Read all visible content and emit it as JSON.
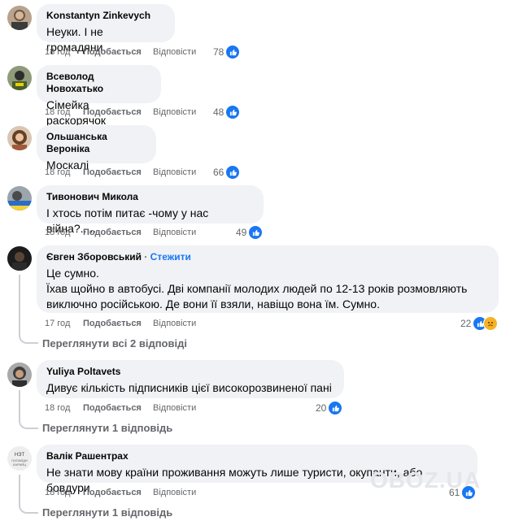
{
  "comments": [
    {
      "author": "Konstantyn Zinkevych",
      "text": "Неуки. І не громадяни.",
      "time": "18 год",
      "like": "Подобається",
      "reply": "Відповісти",
      "count": "78"
    },
    {
      "author": "Всеволод Новохатько",
      "text": "Сімейка раскорячок",
      "time": "18 год",
      "like": "Подобається",
      "reply": "Відповісти",
      "count": "48"
    },
    {
      "author": "Ольшанська Вероніка",
      "text": "Москалі",
      "time": "18 год",
      "like": "Подобається",
      "reply": "Відповісти",
      "count": "66"
    },
    {
      "author": "Тивонович Микола",
      "text": "І хтось потім питає -чому у нас війна?.....",
      "time": "18 год",
      "like": "Подобається",
      "reply": "Відповісти",
      "count": "49"
    },
    {
      "author": "Євген Зборовський",
      "follow_dot": "·",
      "follow": "Стежити",
      "line1": "Це сумно.",
      "line2": "Їхав щойно в автобусі. Дві компанії молодих людей по 12-13 років розмовляють",
      "line3": "виключно російською. Де вони її взяли, навіщо вона їм. Сумно.",
      "time": "17 год",
      "like": "Подобається",
      "reply": "Відповісти",
      "count": "22",
      "see_replies": "Переглянути всі 2 відповіді"
    },
    {
      "author": "Yuliya Poltavets",
      "text": "Дивує кількість підписників цієї високорозвиненої пані",
      "time": "18 год",
      "like": "Подобається",
      "reply": "Відповісти",
      "count": "20",
      "see_replies": "Переглянути 1 відповідь"
    },
    {
      "author": "Валік Рашентрах",
      "text": "Не знати мову країни проживання можуть лише туристи, окупанти, або бовдури",
      "time": "18 год",
      "like": "Подобається",
      "reply": "Відповісти",
      "count": "61",
      "see_replies": "Переглянути 1 відповідь"
    }
  ],
  "watermark": "OBOZ.UA",
  "colors": {
    "link": "#1877f2",
    "bubble": "#f0f2f5",
    "muted": "#65676b",
    "sad": "#f7b125"
  }
}
